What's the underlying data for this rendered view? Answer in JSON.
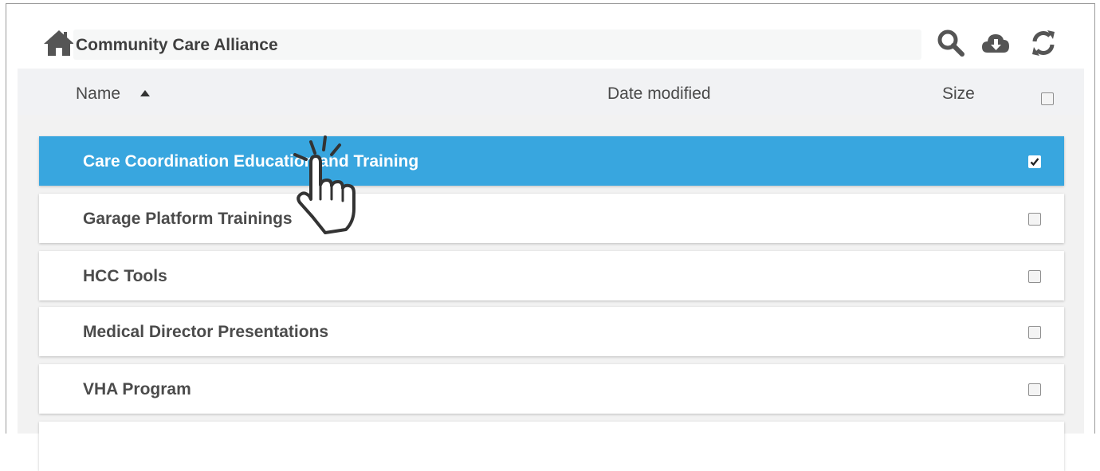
{
  "header": {
    "path": "Community Care Alliance",
    "icons": [
      "home-icon",
      "search-icon",
      "cloud-download-icon",
      "refresh-icon"
    ]
  },
  "columns": {
    "name": "Name",
    "sort": "ascending",
    "date_modified": "Date modified",
    "size": "Size",
    "select_all_checked": false
  },
  "rows": [
    {
      "label": "Care Coordination Education and Training",
      "selected": true,
      "checked": true
    },
    {
      "label": "Garage Platform Trainings",
      "selected": false,
      "checked": false
    },
    {
      "label": "HCC Tools",
      "selected": false,
      "checked": false
    },
    {
      "label": "Medical Director Presentations",
      "selected": false,
      "checked": false
    },
    {
      "label": "VHA Program",
      "selected": false,
      "checked": false
    }
  ],
  "colors": {
    "selected_row": "#38a6df",
    "header_bg": "#f1f2f4",
    "text": "#4b4b4b",
    "icon": "#555555"
  },
  "cursor_icon": "pointing-hand-click-icon"
}
